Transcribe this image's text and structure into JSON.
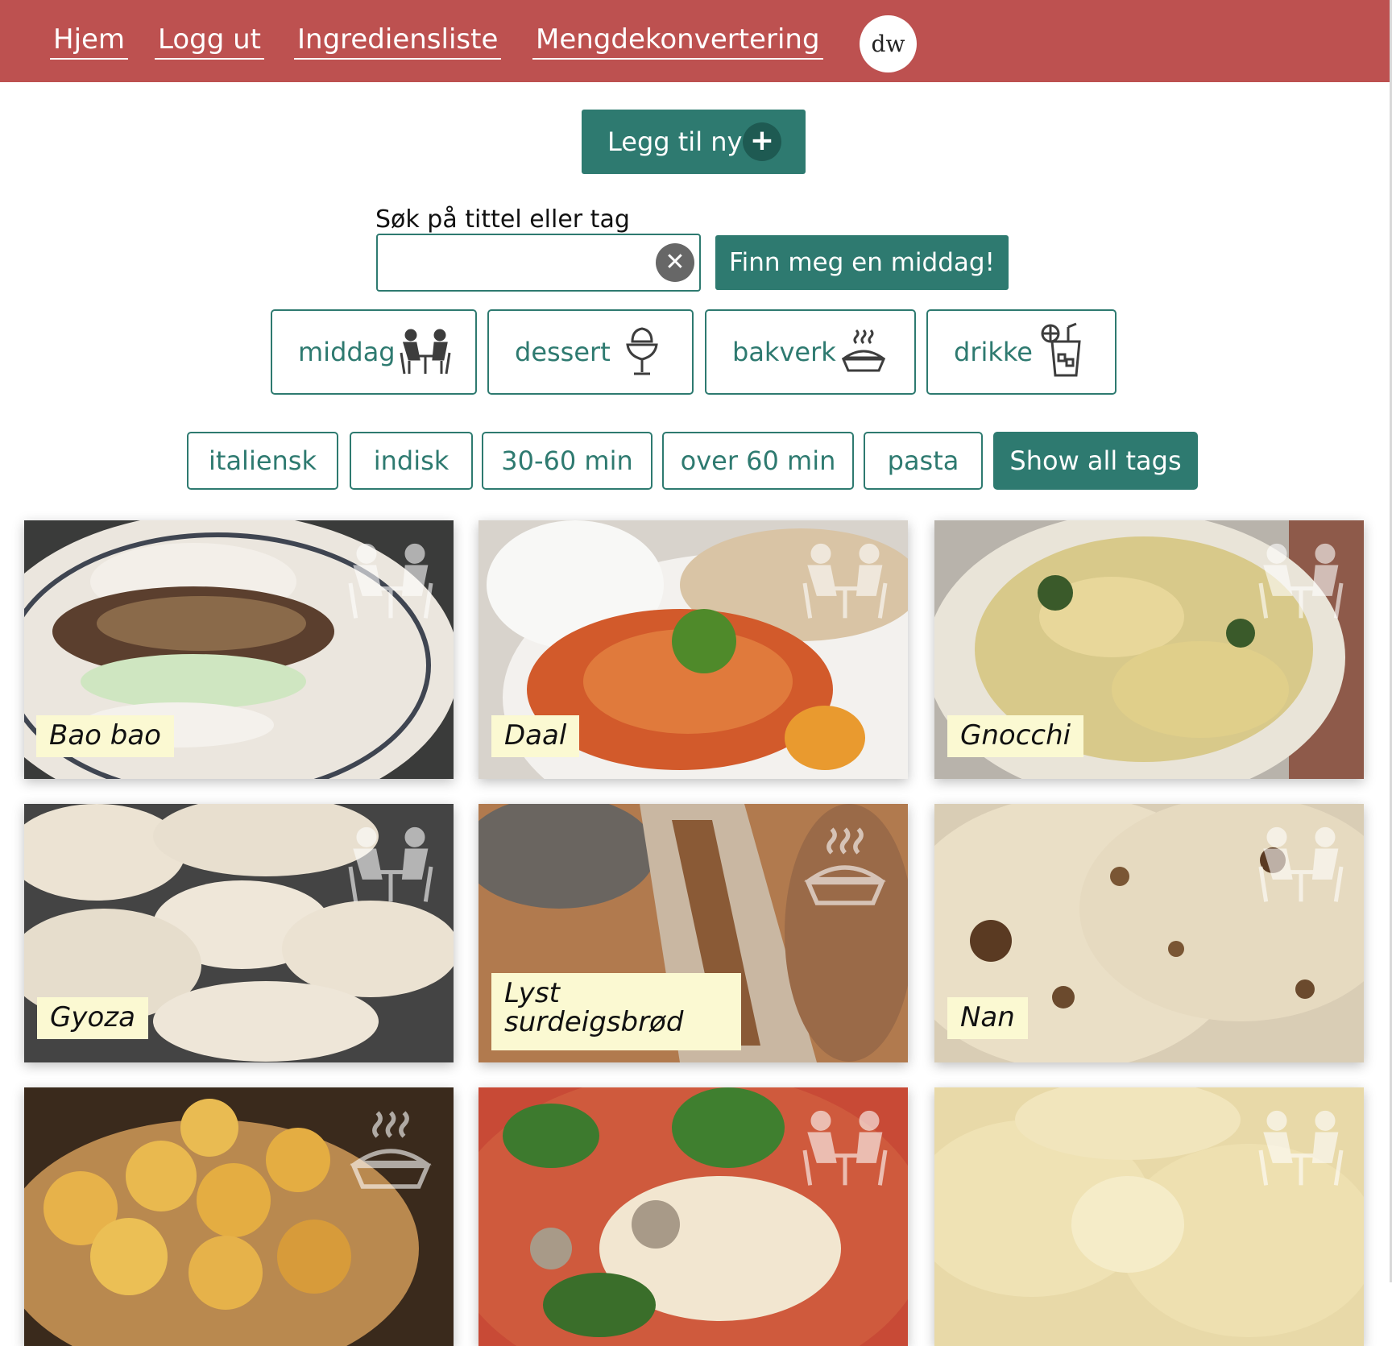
{
  "nav": {
    "home": "Hjem",
    "logout": "Logg ut",
    "ingredients": "Ingrediensliste",
    "conversion": "Mengdekonvertering",
    "avatar": "dw"
  },
  "actions": {
    "add_new": "Legg til ny",
    "add_icon": "plus-icon"
  },
  "search": {
    "label": "Søk på tittel eller tag",
    "value": "",
    "placeholder": "",
    "find_dinner": "Finn meg en middag!"
  },
  "categories": [
    {
      "label": "middag",
      "icon": "dinner-people-icon"
    },
    {
      "label": "dessert",
      "icon": "ice-cream-sundae-icon"
    },
    {
      "label": "bakverk",
      "icon": "pie-icon"
    },
    {
      "label": "drikke",
      "icon": "drink-glass-icon"
    }
  ],
  "tags": [
    "italiensk",
    "indisk",
    "30-60 min",
    "over 60 min",
    "pasta"
  ],
  "show_all_tags": "Show all tags",
  "recipes": [
    {
      "title": "Bao bao",
      "category_icon": "dinner-people-icon"
    },
    {
      "title": "Daal",
      "category_icon": "dinner-people-icon"
    },
    {
      "title": "Gnocchi",
      "category_icon": "dinner-people-icon"
    },
    {
      "title": "Gyoza",
      "category_icon": "dinner-people-icon"
    },
    {
      "title": "Lyst surdeigsbrød",
      "category_icon": "pie-icon"
    },
    {
      "title": "Nan",
      "category_icon": "dinner-people-icon"
    },
    {
      "title": "",
      "category_icon": "pie-icon"
    },
    {
      "title": "",
      "category_icon": "dinner-people-icon"
    },
    {
      "title": "",
      "category_icon": "dinner-people-icon"
    }
  ],
  "colors": {
    "header": "#bd5150",
    "accent": "#2e7a70",
    "title_note": "#fbf9d2"
  }
}
